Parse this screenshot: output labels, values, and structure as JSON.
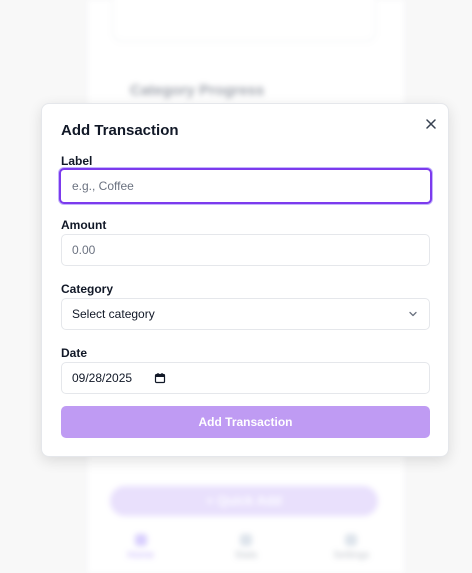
{
  "background": {
    "heading": "Category Progress",
    "button_label": "Quick Add",
    "nav": [
      "Home",
      "Stats",
      "Settings"
    ]
  },
  "modal": {
    "title": "Add Transaction",
    "close_icon": "close-icon",
    "fields": {
      "label": {
        "label": "Label",
        "placeholder": "e.g., Coffee",
        "value": ""
      },
      "amount": {
        "label": "Amount",
        "placeholder": "0.00",
        "value": ""
      },
      "category": {
        "label": "Category",
        "selected": "Select category",
        "icon": "chevron-down-icon"
      },
      "date": {
        "label": "Date",
        "value": "09/28/2025",
        "icon": "calendar-icon"
      }
    },
    "submit_label": "Add Transaction"
  },
  "colors": {
    "accent": "#7c3aed",
    "submit_bg": "#bf9bf3",
    "text": "#111827",
    "border": "#e5e7eb"
  }
}
